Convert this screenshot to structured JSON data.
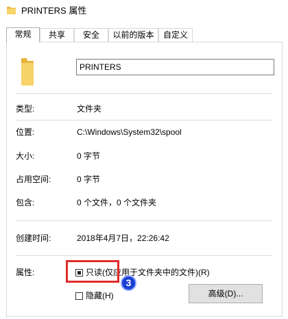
{
  "window": {
    "title": "PRINTERS 属性",
    "folder_icon": "folder-icon"
  },
  "tabs": [
    {
      "label": "常规",
      "active": true
    },
    {
      "label": "共享",
      "active": false
    },
    {
      "label": "安全",
      "active": false
    },
    {
      "label": "以前的版本",
      "active": false
    },
    {
      "label": "自定义",
      "active": false
    }
  ],
  "general": {
    "name_value": "PRINTERS",
    "type_label": "类型:",
    "type_value": "文件夹",
    "location_label": "位置:",
    "location_value": "C:\\Windows\\System32\\spool",
    "size_label": "大小:",
    "size_value": "0 字节",
    "size_on_disk_label": "占用空间:",
    "size_on_disk_value": "0 字节",
    "contains_label": "包含:",
    "contains_value": "0 个文件，0 个文件夹",
    "created_label": "创建时间:",
    "created_value": "2018年4月7日，22:26:42",
    "attributes_label": "属性:",
    "readonly_label": "只读(仅应用于文件夹中的文件)(R)",
    "readonly_state": "indeterminate",
    "hidden_label": "隐藏(H)",
    "hidden_checked": false,
    "advanced_button": "高级(D)..."
  },
  "annotation": {
    "step_number": "3",
    "highlight_color": "#e22a2a",
    "badge_color": "#1b3fd3"
  },
  "colors": {
    "folder": "#f8d36a",
    "folder_dark": "#e8b23a",
    "panel_border": "#d9d9d9"
  }
}
